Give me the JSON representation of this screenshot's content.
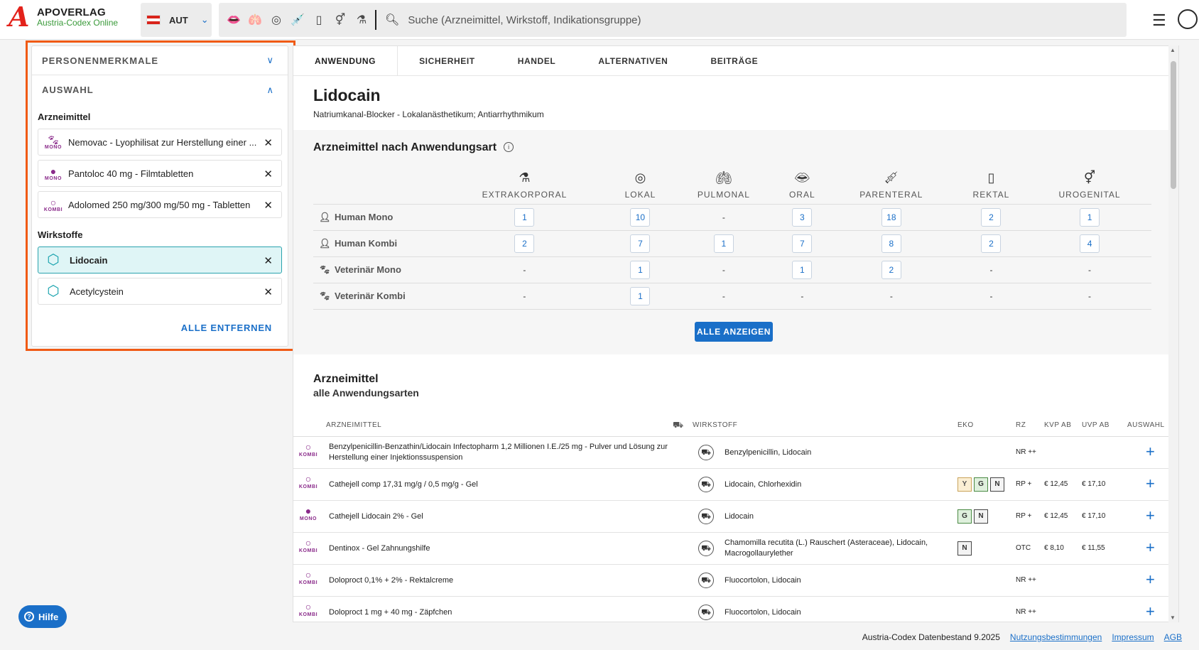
{
  "header": {
    "brand": "APOVERLAG",
    "brand_sub": "Austria-Codex Online",
    "logo_letter": "A",
    "country_code": "AUT",
    "search_placeholder": "Suche (Arzneimittel, Wirkstoff, Indikationsgruppe)",
    "category_icons": [
      "oral-lips-icon",
      "pulmonal-lungs-icon",
      "lokal-icon",
      "parenteral-syringe-icon",
      "rektal-icon",
      "urogenital-icon",
      "extrakorporal-icon"
    ]
  },
  "sidebar": {
    "personen": "PERSONENMERKMALE",
    "auswahl": "AUSWAHL",
    "arzneimittel_label": "Arzneimittel",
    "arzneimittel": [
      {
        "kind": "MONO",
        "label": "Nemovac - Lyophilisat zur Herstellung einer ...",
        "glyph": "🐾"
      },
      {
        "kind": "MONO",
        "label": "Pantoloc 40 mg - Filmtabletten",
        "glyph": "👤"
      },
      {
        "kind": "KOMBI",
        "label": "Adolomed 250 mg/300 mg/50 mg - Tabletten",
        "glyph": "👤"
      }
    ],
    "wirkstoffe_label": "Wirkstoffe",
    "wirkstoffe": [
      {
        "label": "Lidocain",
        "active": true
      },
      {
        "label": "Acetylcystein",
        "active": false
      }
    ],
    "remove_all": "ALLE ENTFERNEN"
  },
  "tabs": [
    "ANWENDUNG",
    "SICHERHEIT",
    "HANDEL",
    "ALTERNATIVEN",
    "BEITRÄGE"
  ],
  "substance": {
    "title": "Lidocain",
    "subtitle": "Natriumkanal-Blocker - Lokalanästhetikum; Antiarrhythmikum"
  },
  "application": {
    "title": "Arzneimittel nach Anwendungsart",
    "columns": [
      "EXTRAKORPORAL",
      "LOKAL",
      "PULMONAL",
      "ORAL",
      "PARENTERAL",
      "REKTAL",
      "UROGENITAL"
    ],
    "rows": [
      {
        "label": "Human Mono",
        "values": [
          "1",
          "10",
          "-",
          "3",
          "18",
          "2",
          "1"
        ]
      },
      {
        "label": "Human Kombi",
        "values": [
          "2",
          "7",
          "1",
          "7",
          "8",
          "2",
          "4"
        ]
      },
      {
        "label": "Veterinär Mono",
        "values": [
          "-",
          "1",
          "-",
          "1",
          "2",
          "-",
          "-"
        ]
      },
      {
        "label": "Veterinär Kombi",
        "values": [
          "-",
          "1",
          "-",
          "-",
          "-",
          "-",
          "-"
        ]
      }
    ],
    "show_all": "ALLE ANZEIGEN"
  },
  "list": {
    "title": "Arzneimittel",
    "subtitle": "alle Anwendungsarten",
    "headers": {
      "arzneimittel": "ARZNEIMITTEL",
      "wirkstoff": "WIRKSTOFF",
      "eko": "EKO",
      "rz": "RZ",
      "kvp": "KVP AB",
      "uvp": "UVP AB",
      "auswahl": "AUSWAHL"
    },
    "rows": [
      {
        "kind": "KOMBI",
        "name": "Benzylpenicillin-Benzathin/Lidocain Infectopharm 1,2 Millionen I.E./25 mg - Pulver und Lösung zur Herstellung einer Injektionssuspension",
        "wirkstoff": "Benzylpenicillin, Lidocain",
        "eko": [],
        "rz": "NR ++",
        "kvp": "",
        "uvp": ""
      },
      {
        "kind": "KOMBI",
        "name": "Cathejell comp 17,31 mg/g / 0,5 mg/g - Gel",
        "wirkstoff": "Lidocain, Chlorhexidin",
        "eko": [
          "Y",
          "G",
          "N"
        ],
        "rz": "RP +",
        "kvp": "€ 12,45",
        "uvp": "€ 17,10"
      },
      {
        "kind": "MONO",
        "name": "Cathejell Lidocain 2% - Gel",
        "wirkstoff": "Lidocain",
        "eko": [
          "G",
          "N"
        ],
        "rz": "RP +",
        "kvp": "€ 12,45",
        "uvp": "€ 17,10"
      },
      {
        "kind": "KOMBI",
        "name": "Dentinox - Gel Zahnungshilfe",
        "wirkstoff": "Chamomilla recutita (L.) Rauschert (Asteraceae), Lidocain, Macrogollaurylether",
        "eko": [
          "N"
        ],
        "rz": "OTC",
        "kvp": "€ 8,10",
        "uvp": "€ 11,55"
      },
      {
        "kind": "KOMBI",
        "name": "Doloproct 0,1% + 2% - Rektalcreme",
        "wirkstoff": "Fluocortolon, Lidocain",
        "eko": [],
        "rz": "NR ++",
        "kvp": "",
        "uvp": ""
      },
      {
        "kind": "KOMBI",
        "name": "Doloproct 1 mg + 40 mg - Zäpfchen",
        "wirkstoff": "Fluocortolon, Lidocain",
        "eko": [],
        "rz": "NR ++",
        "kvp": "",
        "uvp": ""
      }
    ]
  },
  "footer": {
    "text": "Austria-Codex Datenbestand 9.2025",
    "links": [
      "Nutzungsbestimmungen",
      "Impressum",
      "AGB"
    ]
  },
  "help": "Hilfe",
  "colors": {
    "accent": "#1a6fc8",
    "highlight_outline": "#f05a14",
    "brand_red": "#e3221b",
    "wirkstoff_teal": "#17a2ad",
    "person_purple": "#8a2a8a"
  }
}
